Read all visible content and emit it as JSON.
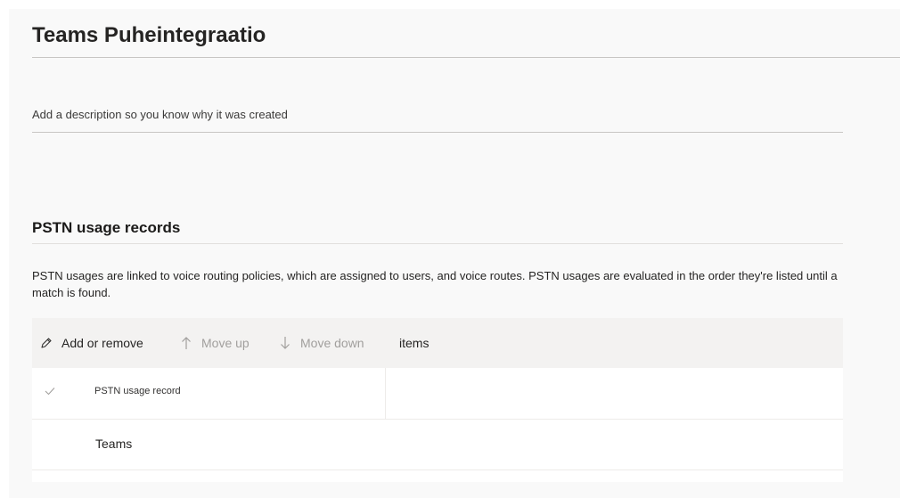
{
  "policy": {
    "title": "Teams Puheintegraatio",
    "description_placeholder": "Add a description so you know why it was created",
    "description_value": ""
  },
  "pstn_section": {
    "title": "PSTN usage records",
    "description": "PSTN usages are linked to voice routing policies, which are assigned to users, and voice routes. PSTN usages are evaluated in the order they're listed until a match is found."
  },
  "toolbar": {
    "add_remove_label": "Add or remove",
    "move_up_label": "Move up",
    "move_down_label": "Move down",
    "item_count_label": "items"
  },
  "table": {
    "columns": [
      "PSTN usage record"
    ],
    "rows": [
      {
        "pstn_usage_record": "Teams"
      }
    ]
  },
  "icons": {
    "add_remove": "pencil-icon",
    "move_up": "arrow-up-icon",
    "move_down": "arrow-down-icon",
    "select_all": "checkmark-icon"
  },
  "colors": {
    "panel_background": "#f9f9f9",
    "toolbar_background": "#f3f2f1",
    "disabled_text": "#a19f9d",
    "primary_text": "#252423"
  }
}
